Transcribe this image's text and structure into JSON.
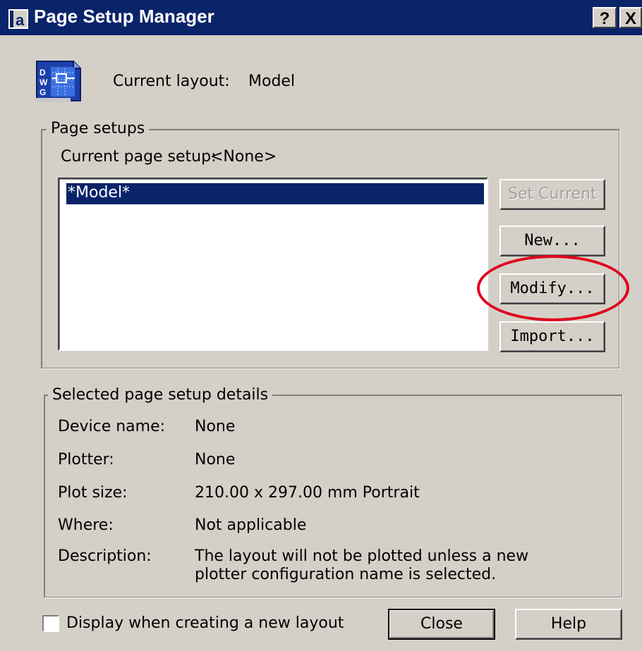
{
  "window": {
    "title": "Page Setup Manager",
    "help_glyph": "?",
    "close_glyph": "X",
    "app_icon": "app-a-icon"
  },
  "header": {
    "icon": "dwg-file-icon",
    "current_layout_label": "Current layout:",
    "current_layout_value": "Model"
  },
  "page_setups": {
    "legend": "Page setups",
    "current_setup_label": "Current page setup:",
    "current_setup_value": "<None>",
    "list_items": [
      "*Model*"
    ],
    "buttons": {
      "set_current": "Set Current",
      "new": "New...",
      "modify": "Modify...",
      "import": "Import..."
    }
  },
  "details": {
    "legend": "Selected page setup details",
    "rows": [
      {
        "label": "Device name:",
        "value": "None"
      },
      {
        "label": "Plotter:",
        "value": "None"
      },
      {
        "label": "Plot size:",
        "value": "210.00 x 297.00 mm Portrait"
      },
      {
        "label": "Where:",
        "value": "Not applicable"
      },
      {
        "label": "Description:",
        "value": "The layout will not be plotted unless a new plotter configuration name is selected."
      }
    ]
  },
  "footer": {
    "checkbox_label": "Display when creating a new layout",
    "checkbox_checked": false,
    "close_button": "Close",
    "help_button": "Help"
  },
  "annotation_color": "#e0001a"
}
